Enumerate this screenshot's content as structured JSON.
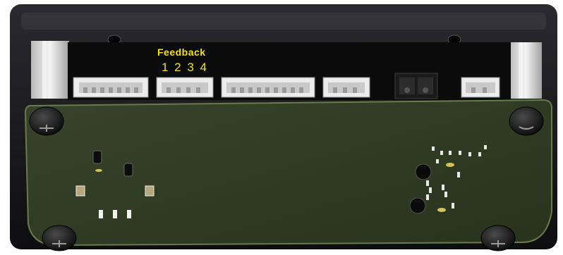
{
  "label": {
    "title": "Feedback",
    "numbers": "1 2 3 4"
  },
  "colors": {
    "enclosure": "#1c1c1f",
    "pcb": "#2f3a21",
    "label_text": "#f2e21a",
    "connector": "#e9e9e9"
  }
}
